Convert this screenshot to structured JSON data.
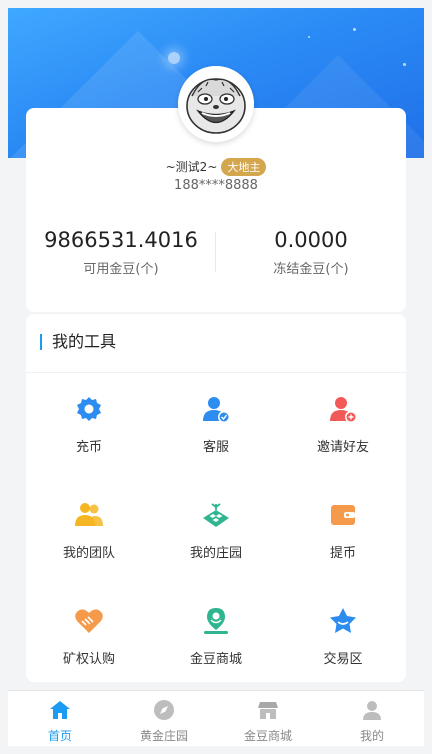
{
  "profile": {
    "nickname": "~测试2~",
    "badge": "大地主",
    "phone": "188****8888"
  },
  "stats": [
    {
      "value": "9866531.4016",
      "label": "可用金豆(个)"
    },
    {
      "value": "0.0000",
      "label": "冻结金豆(个)"
    }
  ],
  "tools": {
    "title": "我的工具",
    "items": [
      {
        "label": "充币",
        "icon": "gear-icon",
        "color": "#2d8cf0"
      },
      {
        "label": "客服",
        "icon": "customer-service-icon",
        "color": "#2d8cf0"
      },
      {
        "label": "邀请好友",
        "icon": "invite-user-icon",
        "color": "#f25a5a"
      },
      {
        "label": "我的团队",
        "icon": "team-icon",
        "color": "#f5b623"
      },
      {
        "label": "我的庄园",
        "icon": "farm-icon",
        "color": "#2fb58f"
      },
      {
        "label": "提币",
        "icon": "wallet-icon",
        "color": "#f59a4b"
      },
      {
        "label": "矿权认购",
        "icon": "handshake-heart-icon",
        "color": "#f59a4b"
      },
      {
        "label": "金豆商城",
        "icon": "location-pin-icon",
        "color": "#2fb58f"
      },
      {
        "label": "交易区",
        "icon": "star-icon",
        "color": "#2d8cf0"
      }
    ]
  },
  "tabbar": [
    {
      "label": "首页",
      "icon": "home-icon",
      "active": true
    },
    {
      "label": "黄金庄园",
      "icon": "compass-icon",
      "active": false
    },
    {
      "label": "金豆商城",
      "icon": "shop-icon",
      "active": false
    },
    {
      "label": "我的",
      "icon": "user-icon",
      "active": false
    }
  ],
  "colors": {
    "accent": "#1b9cf2",
    "badge": "#d4a64d",
    "banner": "#2b8bf5"
  }
}
